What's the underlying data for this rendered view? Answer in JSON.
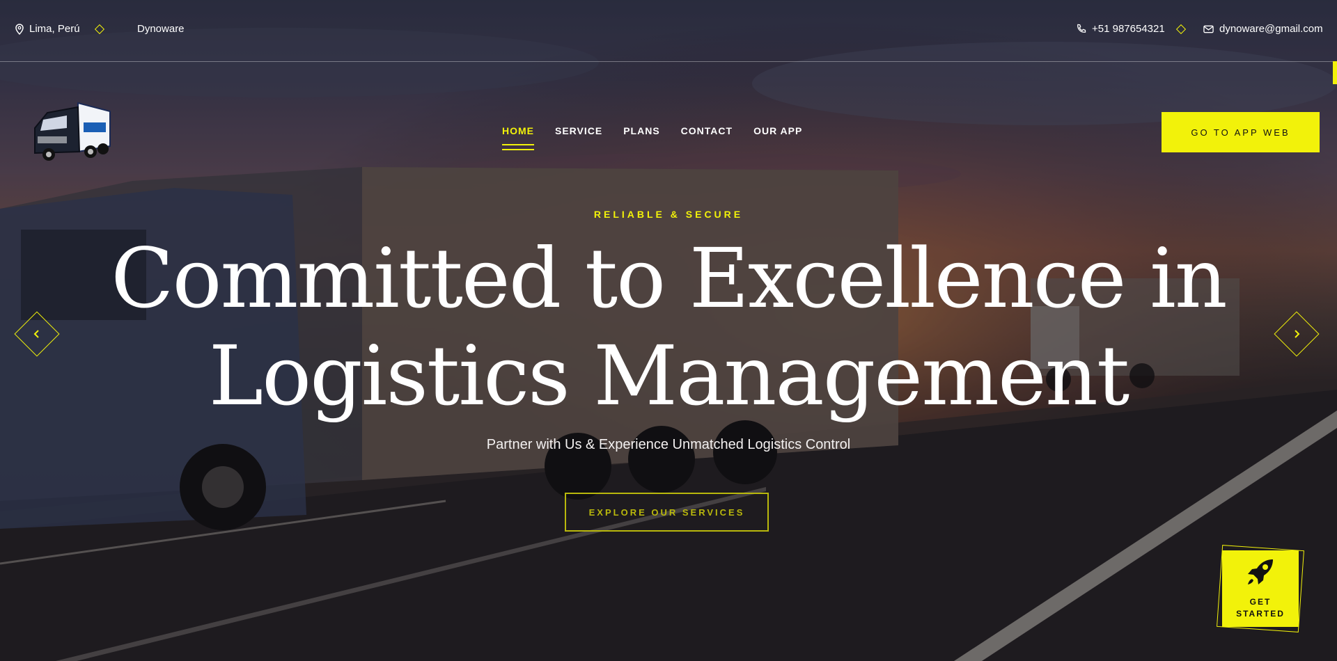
{
  "topbar": {
    "location": "Lima, Perú",
    "company": "Dynoware",
    "phone": "+51 987654321",
    "email": "dynoware@gmail.com"
  },
  "nav": {
    "items": [
      {
        "label": "HOME",
        "active": true
      },
      {
        "label": "SERVICE"
      },
      {
        "label": "PLANS"
      },
      {
        "label": "CONTACT"
      },
      {
        "label": "OUR APP"
      }
    ],
    "cta_label": "GO TO APP WEB"
  },
  "hero": {
    "kicker": "RELIABLE & SECURE",
    "headline_line1": "Committed to Excellence in",
    "headline_line2": "Logistics Management",
    "subline": "Partner with Us & Experience Unmatched Logistics Control",
    "button_label": "EXPLORE OUR SERVICES"
  },
  "get_started": {
    "line1": "GET",
    "line2": "STARTED",
    "icon": "rocket-icon"
  },
  "colors": {
    "accent": "#f2f20a",
    "dim_accent": "#b9b80c",
    "text": "#ffffff"
  }
}
